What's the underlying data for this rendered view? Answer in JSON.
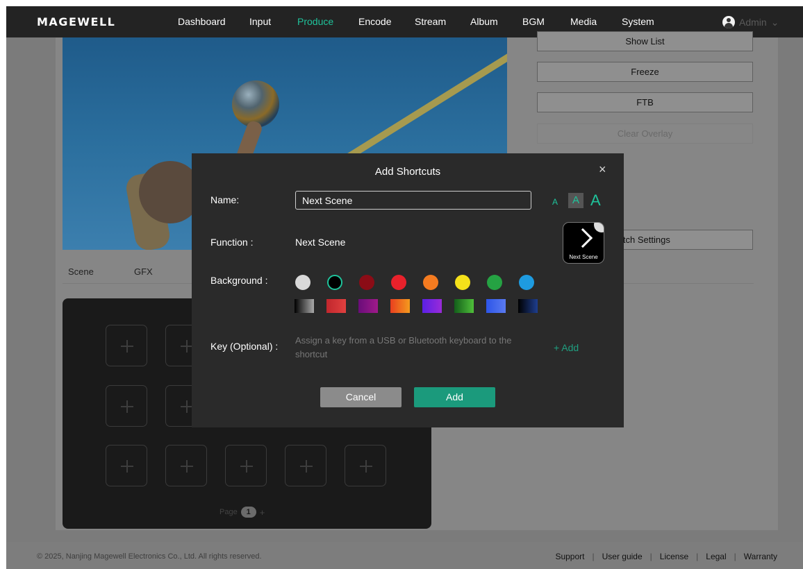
{
  "brand": {
    "logo": "MAGEWELL",
    "accent": "#1fc39b"
  },
  "nav": {
    "items": [
      "Dashboard",
      "Input",
      "Produce",
      "Encode",
      "Stream",
      "Album",
      "BGM",
      "Media",
      "System"
    ],
    "active": "Produce",
    "user": "Admin"
  },
  "side_buttons": {
    "show_list": "Show List",
    "freeze": "Freeze",
    "ftb": "FTB",
    "clear_overlay": "Clear Overlay",
    "switch_settings": "itch Settings"
  },
  "tabs": [
    "Scene",
    "GFX"
  ],
  "grid": {
    "page_label": "Page",
    "page_number": "1",
    "add_page": "+"
  },
  "modal": {
    "title": "Add Shortcuts",
    "close": "×",
    "name_label": "Name:",
    "name_value": "Next Scene",
    "font_sizes": [
      "A",
      "A",
      "A"
    ],
    "function_label": "Function :",
    "function_value": "Next Scene",
    "preview_label": "Next Scene",
    "background_label": "Background :",
    "solid_colors": [
      "#d9d9d9",
      "#000000",
      "#8b0c16",
      "#e8212b",
      "#f47b20",
      "#f5e11a",
      "#25a243",
      "#1e9be0"
    ],
    "gradients": [
      "linear-gradient(90deg,#000,#aaa)",
      "linear-gradient(90deg,#c1272d,#e0403f)",
      "linear-gradient(90deg,#6a0d7a,#a01a8a)",
      "linear-gradient(90deg,#e93f1f,#f49b1e)",
      "linear-gradient(90deg,#5a20e6,#9a2bd8)",
      "linear-gradient(90deg,#135e1a,#4fbf3a)",
      "linear-gradient(90deg,#2d55e8,#5a7af0)",
      "linear-gradient(90deg,#000,#1e3e8f)"
    ],
    "key_label": "Key (Optional) :",
    "key_hint": "Assign a key from a USB or Bluetooth keyboard to the shortcut",
    "add_key": "+ Add",
    "cancel": "Cancel",
    "add": "Add"
  },
  "footer": {
    "copyright": "© 2025, Nanjing Magewell Electronics Co., Ltd. All rights reserved.",
    "links": [
      "Support",
      "User guide",
      "License",
      "Legal",
      "Warranty"
    ]
  }
}
